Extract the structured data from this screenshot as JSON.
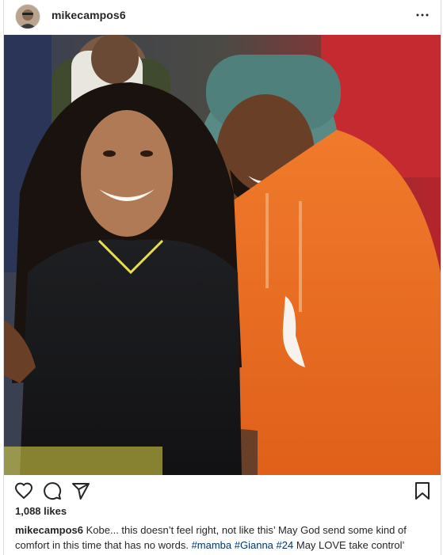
{
  "post": {
    "username": "mikecampos6",
    "more_icon": "more-horizontal-icon",
    "likes": "1,088 likes",
    "caption": {
      "username": "mikecampos6",
      "text_part1": "Kobe... this doesn’t feel right, not like this’ May God send some kind of comfort in this time that has no words.",
      "tags": [
        "#mamba",
        "#Gianna",
        "#24"
      ],
      "text_part2": "May LOVE take control’"
    },
    "actions": {
      "like_icon": "heart-icon",
      "comment_icon": "comment-icon",
      "share_icon": "paper-plane-icon",
      "save_icon": "bookmark-icon"
    }
  }
}
